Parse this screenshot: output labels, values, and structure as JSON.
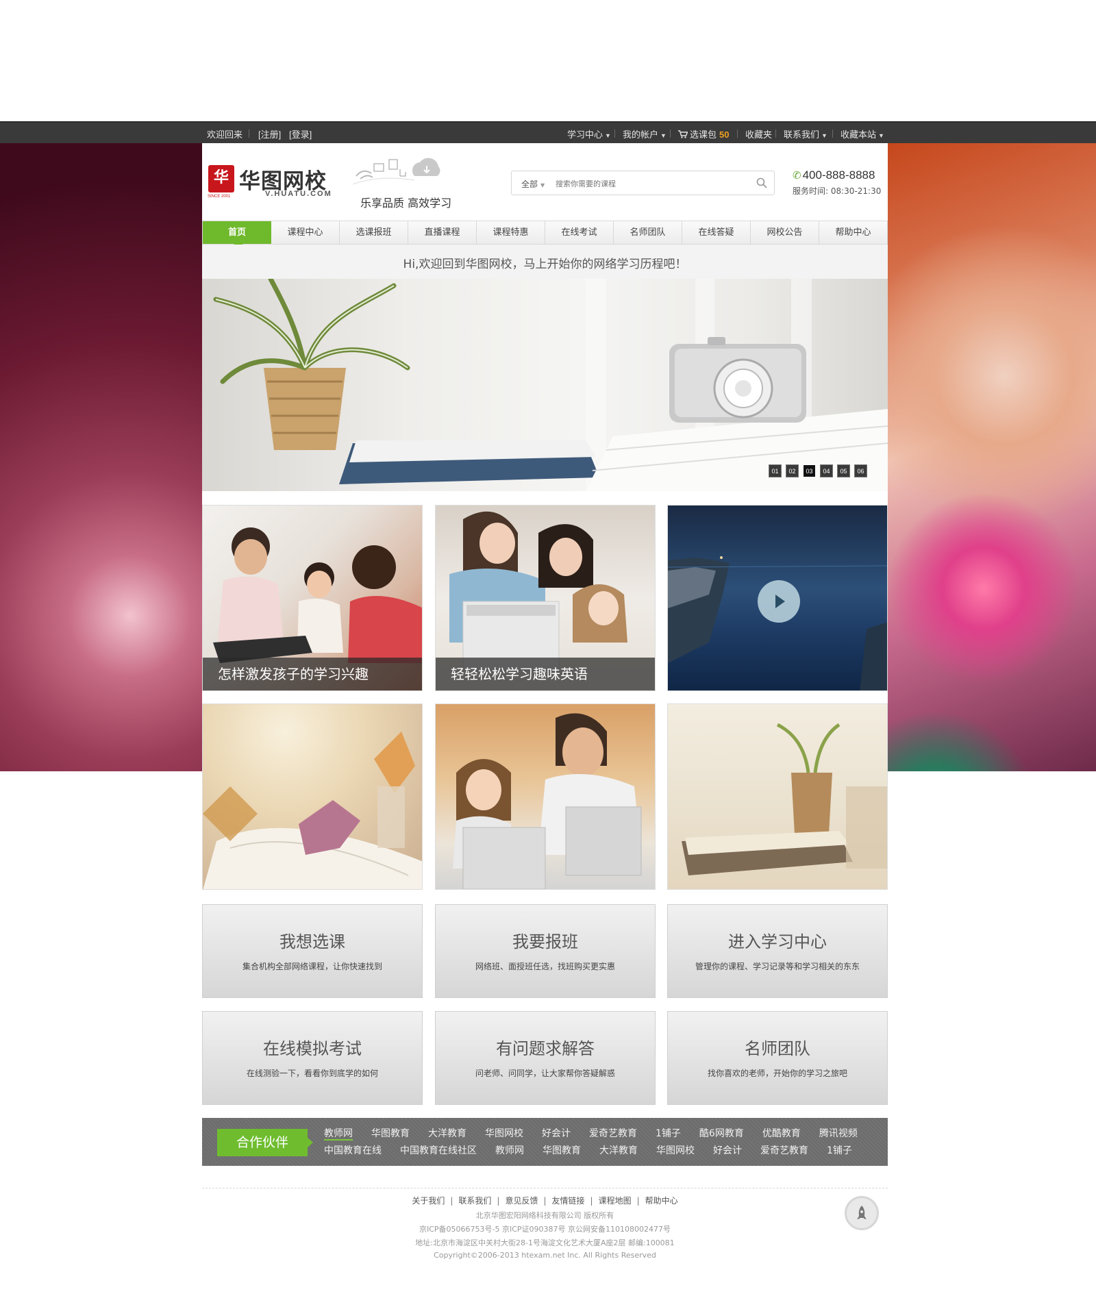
{
  "topbar": {
    "welcome": "欢迎回来",
    "register": "[注册]",
    "login": "[登录]",
    "menu": [
      {
        "label": "学习中心"
      },
      {
        "label": "我的帐户"
      },
      {
        "label": "选课包"
      },
      {
        "label": "收藏夹"
      },
      {
        "label": "联系我们"
      },
      {
        "label": "收藏本站"
      }
    ],
    "cart_count": "50"
  },
  "header": {
    "logo_mark": "华",
    "logo_since": "SINCE 2001",
    "logo_name": "华图网校",
    "logo_url": "V.HUATU.COM",
    "slogan": "乐享品质  高效学习",
    "search_category": "全部",
    "search_placeholder": "搜索你需要的课程",
    "phone": "400-888-8888",
    "hours": "服务时间: 08:30-21:30"
  },
  "nav": {
    "items": [
      "首页",
      "课程中心",
      "选课报班",
      "直播课程",
      "课程特惠",
      "在线考试",
      "名师团队",
      "在线答疑",
      "网校公告",
      "帮助中心"
    ]
  },
  "welcome_text": "Hi,欢迎回到华图网校，马上开始你的网络学习历程吧！",
  "banner": {
    "pages": [
      "01",
      "02",
      "03",
      "04",
      "05",
      "06"
    ],
    "active_page": "03"
  },
  "tiles": [
    {
      "caption": "怎样激发孩子的学习兴趣"
    },
    {
      "caption": "轻轻松松学习趣味英语"
    }
  ],
  "actions": [
    {
      "title": "我想选课",
      "desc": "集合机构全部网络课程，让你快速找到"
    },
    {
      "title": "我要报班",
      "desc": "网络班、面授班任选，找班购买更实惠"
    },
    {
      "title": "进入学习中心",
      "desc": "管理你的课程、学习记录等和学习相关的东东"
    },
    {
      "title": "在线模拟考试",
      "desc": "在线测验一下，看看你到底学的如何"
    },
    {
      "title": "有问题求解答",
      "desc": "问老师、问同学，让大家帮你答疑解惑"
    },
    {
      "title": "名师团队",
      "desc": "找你喜欢的老师，开始你的学习之旅吧"
    }
  ],
  "partners": {
    "title": "合作伙伴",
    "row1": [
      "教师网",
      "华图教育",
      "大洋教育",
      "华图网校",
      "好会计",
      "爱奇艺教育",
      "1铺子",
      "酷6网教育",
      "优酷教育",
      "腾讯视频"
    ],
    "row2": [
      "中国教育在线",
      "中国教育在线社区",
      "教师网",
      "华图教育",
      "大洋教育",
      "华图网校",
      "好会计",
      "爱奇艺教育",
      "1铺子"
    ]
  },
  "footer": {
    "links": [
      "关于我们",
      "联系我们",
      "意见反馈",
      "友情链接",
      "课程地图",
      "帮助中心"
    ],
    "company": "北京华图宏阳网络科技有限公司 版权所有",
    "icp": "京ICP备05066753号-5 京ICP证090387号 京公网安备110108002477号",
    "address": "地址:北京市海淀区中关村大街28-1号海淀文化艺术大厦A座2层 邮编:100081",
    "copyright": "Copyright©2006-2013 htexam.net Inc. All Rights Reserved"
  },
  "colors": {
    "accent_green": "#6fb92c",
    "brand_red": "#c8161d",
    "topbar": "#3a3a3a",
    "cart_count": "#f0a020"
  },
  "icons": [
    "cart-icon",
    "phone-icon",
    "search-icon",
    "play-icon",
    "rocket-icon",
    "caret-down-icon"
  ]
}
